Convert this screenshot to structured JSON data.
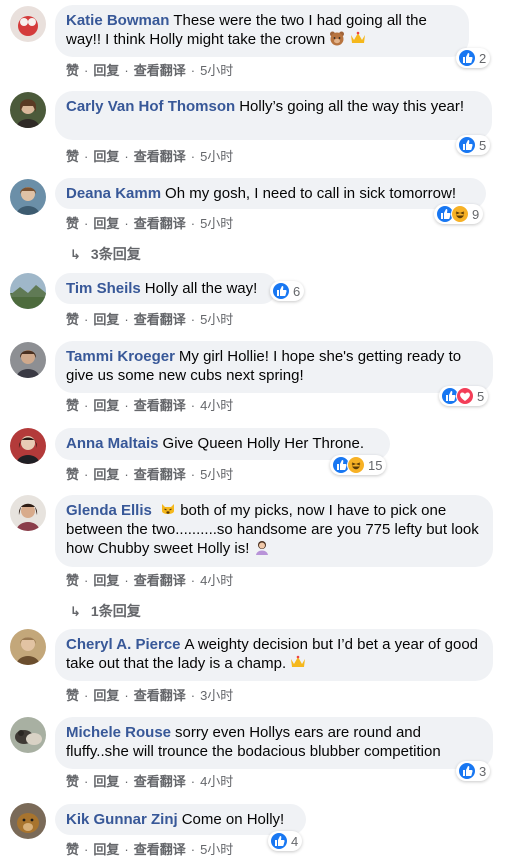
{
  "actions": {
    "like": "赞",
    "reply": "回复",
    "translate": "查看翻译",
    "sep": "·"
  },
  "comments": [
    {
      "author": "Katie Bowman",
      "text": "These were the two I had going all the way!! I think Holly might take the crown",
      "time": "5小时",
      "reaction_count": "2",
      "reactions": [
        "like"
      ],
      "inline_emoji": [
        "bear",
        "crown"
      ]
    },
    {
      "author": "Carly Van Hof Thomson",
      "text": "Holly’s going all the way this year!",
      "time": "5小时",
      "reaction_count": "5",
      "reactions": [
        "like"
      ]
    },
    {
      "author": "Deana Kamm",
      "text": "Oh my gosh, I need to call in sick tomorrow!",
      "time": "5小时",
      "reaction_count": "9",
      "reactions": [
        "like",
        "haha"
      ],
      "replies": "3条回复"
    },
    {
      "author": "Tim Sheils",
      "text": "Holly all the way!",
      "time": "5小时",
      "reaction_count": "6",
      "reactions": [
        "like"
      ]
    },
    {
      "author": "Tammi Kroeger",
      "text": "My girl Hollie! I hope she's getting ready to give us some new cubs next spring!",
      "time": "4小时",
      "reaction_count": "5",
      "reactions": [
        "like",
        "love"
      ]
    },
    {
      "author": "Anna Maltais",
      "text": "Give Queen Holly Her Throne.",
      "time": "5小时",
      "reaction_count": "15",
      "reactions": [
        "like",
        "haha"
      ]
    },
    {
      "author": "Glenda Ellis",
      "text": "both of my picks, now I have to pick one between the two..........so handsome are you 775 lefty but look how Chubby sweet Holly is!",
      "time": "4小时",
      "replies": "1条回复",
      "inline_emoji": [
        "weary-cat",
        "woman-gesture"
      ]
    },
    {
      "author": "Cheryl A. Pierce",
      "text": "A weighty decision but I’d bet a year of good take out that the lady is a champ.",
      "time": "3小时",
      "inline_emoji": [
        "crown"
      ]
    },
    {
      "author": "Michele Rouse",
      "text": "sorry even Hollys ears are round and fluffy..she will trounce the bodacious blubber competition",
      "time": "4小时",
      "reaction_count": "3",
      "reactions": [
        "like"
      ]
    },
    {
      "author": "Kik Gunnar Zinj",
      "text": "Come on Holly!",
      "time": "5小时",
      "reaction_count": "4",
      "reactions": [
        "like"
      ]
    }
  ],
  "colors": {
    "author": "#385898",
    "like": "#1877f2",
    "love": "#f33e58",
    "haha": "#f7b125",
    "meta": "#65676b",
    "bubble": "#f0f2f5"
  }
}
